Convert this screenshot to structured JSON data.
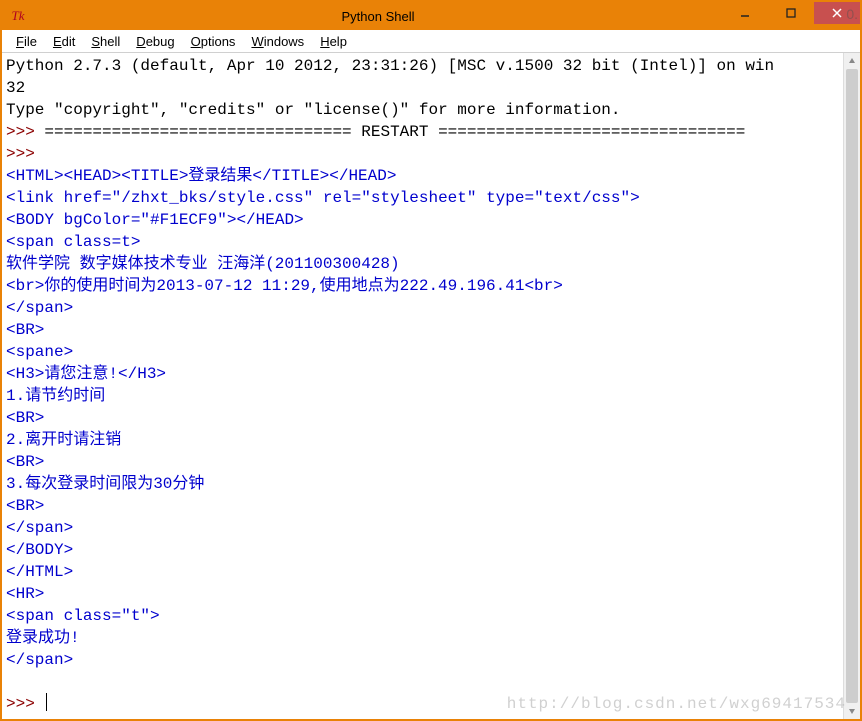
{
  "window": {
    "title": "Python Shell",
    "icon_label": "Tk"
  },
  "menu": {
    "items": [
      {
        "accel": "F",
        "rest": "ile"
      },
      {
        "accel": "E",
        "rest": "dit"
      },
      {
        "accel": "S",
        "rest": "hell"
      },
      {
        "accel": "D",
        "rest": "ebug"
      },
      {
        "accel": "O",
        "rest": "ptions"
      },
      {
        "accel": "W",
        "rest": "indows"
      },
      {
        "accel": "H",
        "rest": "elp"
      }
    ]
  },
  "shell": {
    "banner1": "Python 2.7.3 (default, Apr 10 2012, 23:31:26) [MSC v.1500 32 bit (Intel)] on win",
    "banner2": "32",
    "banner3": "Type \"copyright\", \"credits\" or \"license()\" for more information.",
    "prompt": ">>> ",
    "restart": "================================ RESTART ================================",
    "empty_prompt": ">>> ",
    "html_lines": [
      "<HTML><HEAD><TITLE>登录结果</TITLE></HEAD>",
      "<link href=\"/zhxt_bks/style.css\" rel=\"stylesheet\" type=\"text/css\">",
      "<BODY bgColor=\"#F1ECF9\"></HEAD>",
      "<span class=t>",
      "软件学院 数字媒体技术专业 汪海洋(201100300428)",
      "<br>你的使用时间为2013-07-12 11:29,使用地点为222.49.196.41<br>",
      "</span>",
      "<BR>",
      "<spane>",
      "<H3>请您注意!</H3>",
      "1.请节约时间",
      "<BR>",
      "2.离开时请注销",
      "<BR>",
      "3.每次登录时间限为30分钟",
      "<BR>",
      "</span>",
      "</BODY>",
      "</HTML>",
      "<HR>",
      "<span class=\"t\">",
      "登录成功!",
      "</span>"
    ],
    "final_prompt": ">>> "
  },
  "overlay": {
    "right": "0.",
    "watermark": "http://blog.csdn.net/wxg69417534"
  }
}
